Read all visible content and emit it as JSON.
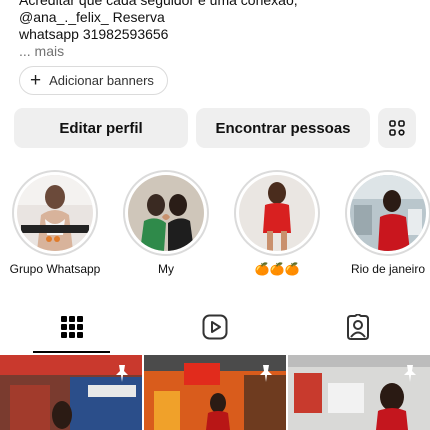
{
  "bio": {
    "line1": "Acreditar que cada seguidor é uma conexão,",
    "line2": "@ana_._felix_ Reserva",
    "line3": "whatsapp 31982593656",
    "more": "... mais"
  },
  "banner_button": {
    "label": "Adicionar banners",
    "icon": "plus-icon"
  },
  "actions": {
    "edit_profile": "Editar perfil",
    "find_people": "Encontrar pessoas",
    "discover_icon": "person-add-icon"
  },
  "highlights": [
    {
      "label": "Grupo Whatsapp",
      "icon": "highlight-cover"
    },
    {
      "label": "My",
      "icon": "highlight-cover"
    },
    {
      "label": "🍊🍊🍊",
      "icon": "highlight-cover"
    },
    {
      "label": "Rio de janeiro",
      "icon": "highlight-cover"
    }
  ],
  "tabs": [
    {
      "name": "posts",
      "icon": "grid-icon",
      "active": true
    },
    {
      "name": "reels",
      "icon": "reels-icon",
      "active": false
    },
    {
      "name": "tagged",
      "icon": "tagged-icon",
      "active": false
    }
  ],
  "posts": [
    {
      "pinned": true,
      "overlay_text": ""
    },
    {
      "pinned": true,
      "overlay_text": ""
    },
    {
      "pinned": true,
      "overlay_text": ""
    }
  ],
  "colors": {
    "button_bg": "#efefef",
    "border": "#dbdbdb",
    "muted": "#737373"
  }
}
